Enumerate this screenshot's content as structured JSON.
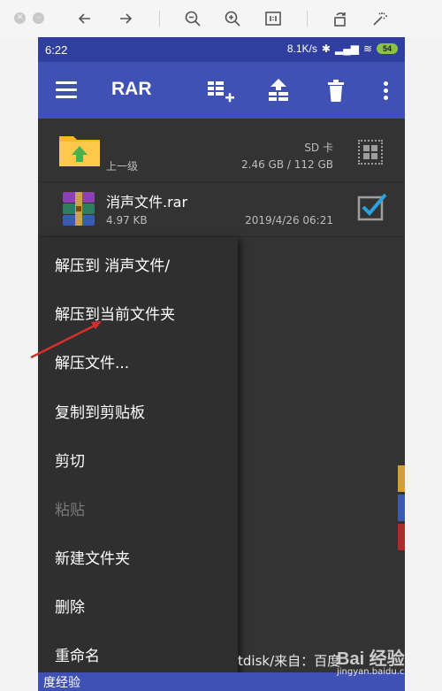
{
  "viewer": {
    "tools": [
      "back-icon",
      "forward-icon",
      "zoom-out-icon",
      "zoom-in-icon",
      "actual-size-icon",
      "rotate-icon",
      "magic-wand-icon"
    ]
  },
  "status_bar": {
    "time": "6:22",
    "speed": "8.1K/s",
    "battery": "54"
  },
  "app_bar": {
    "title": "RAR",
    "icons": [
      "add-to-archive-icon",
      "extract-icon",
      "delete-icon",
      "more-icon"
    ]
  },
  "files": {
    "parent": {
      "label": "上一级",
      "storage_name": "SD 卡",
      "storage_size": "2.46 GB / 112 GB"
    },
    "rar": {
      "name": "消声文件.rar",
      "size": "4.97 KB",
      "date": "2019/4/26 06:21"
    }
  },
  "context_menu": {
    "items": [
      {
        "label": "解压到 消声文件/",
        "enabled": true
      },
      {
        "label": "解压到当前文件夹",
        "enabled": true
      },
      {
        "label": "解压文件...",
        "enabled": true
      },
      {
        "label": "复制到剪贴板",
        "enabled": true
      },
      {
        "label": "剪切",
        "enabled": true
      },
      {
        "label": "粘贴",
        "enabled": false
      },
      {
        "label": "新建文件夹",
        "enabled": true
      },
      {
        "label": "删除",
        "enabled": true
      },
      {
        "label": "重命名",
        "enabled": true
      }
    ]
  },
  "watermark": {
    "partial_text": "tdisk/来自：百度",
    "bottom_text": "度经验",
    "logo": "Bai 经验",
    "url": "jingyan.baidu.com"
  },
  "colors": {
    "status_bar": "#303f9f",
    "app_bar": "#3f51b5",
    "background": "#333333",
    "annotation_arrow": "#d32f2f"
  }
}
